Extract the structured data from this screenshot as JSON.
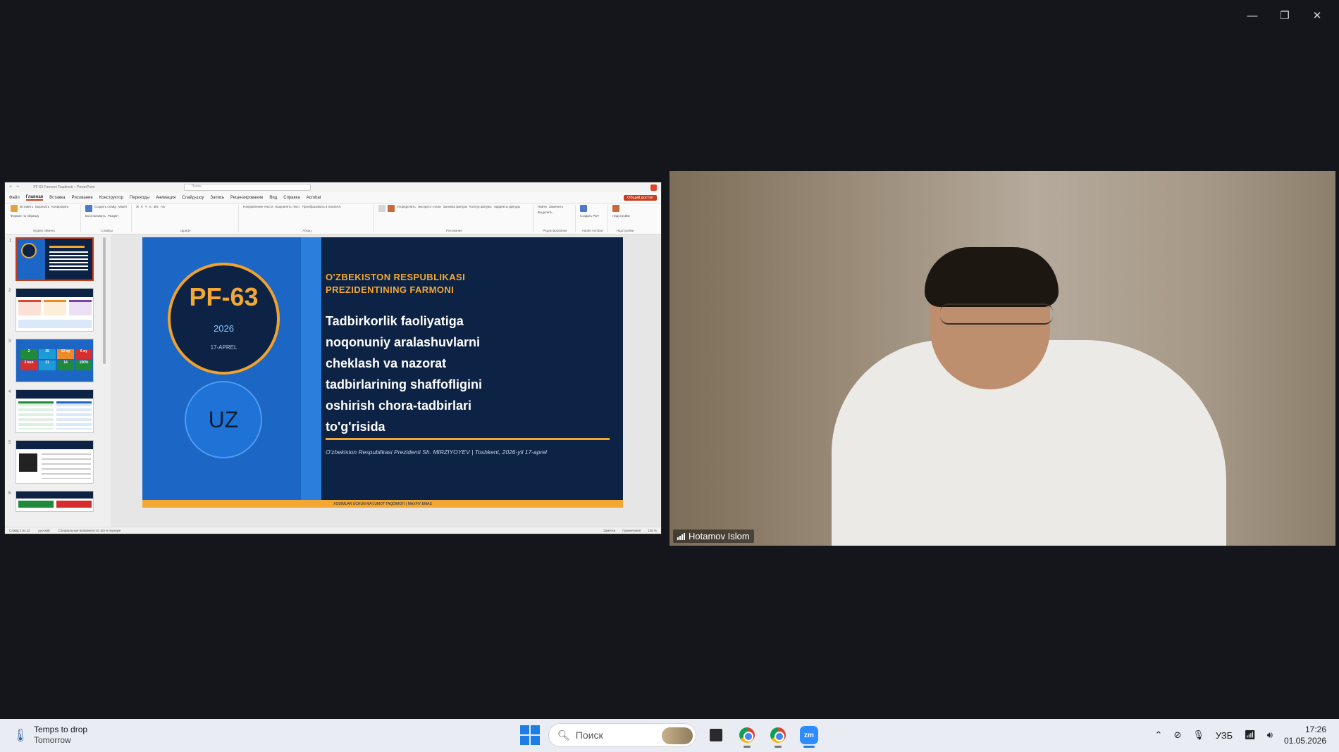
{
  "window_controls": {
    "minimize": "—",
    "restore": "❐",
    "close": "✕"
  },
  "ppt": {
    "title": "PF-63 Farmoni Taqdimoti – PowerPoint",
    "search_placeholder": "Поиск",
    "menu": [
      "Файл",
      "Главная",
      "Вставка",
      "Рисование",
      "Конструктор",
      "Переходы",
      "Анимация",
      "Слайд-шоу",
      "Запись",
      "Рецензирование",
      "Вид",
      "Справка",
      "Acrobat"
    ],
    "share_label": "Общий доступ",
    "ribbon_groups": [
      {
        "items": [
          "Вставить",
          "Вырезать",
          "Копировать",
          "Формат по образцу"
        ],
        "label": "Буфер обмена"
      },
      {
        "items": [
          "Создать слайд",
          "Макет",
          "Восстановить",
          "Раздел"
        ],
        "label": "Слайды"
      },
      {
        "items": [
          "Ж",
          "К",
          "Ч",
          "S",
          "abc",
          "Aa"
        ],
        "label": "Шрифт"
      },
      {
        "items": [
          "Направление текста",
          "Выровнять текст",
          "Преобразовать в SmartArt"
        ],
        "label": "Абзац"
      },
      {
        "items": [
          "Упорядочить",
          "Экспресс-стили",
          "Заливка фигуры",
          "Контур фигуры",
          "Эффекты фигуры"
        ],
        "label": "Рисование"
      },
      {
        "items": [
          "Найти",
          "Заменить",
          "Выделить"
        ],
        "label": "Редактирование"
      },
      {
        "items": [
          "Создать PDF"
        ],
        "label": "Adobe Acrobat"
      },
      {
        "items": [
          "Надстройки"
        ],
        "label": "Надстройки"
      }
    ],
    "thumb_numbers": [
      "1",
      "2",
      "3",
      "4",
      "5",
      "6"
    ],
    "status_left": "Слайд 1 из 12",
    "status_lang": "русский",
    "status_access": "Специальные возможности: все в порядке",
    "status_notes": "Заметки",
    "status_comments": "Примечания",
    "status_zoom": "146 %"
  },
  "slide": {
    "badge_code": "PF-63",
    "badge_year": "2026",
    "badge_date": "17-APREL",
    "country": "UZ",
    "title_lines": [
      "O'ZBEKISTON RESPUBLIKASI",
      "PREZIDENTINING FARMONI"
    ],
    "body_lines": [
      "Tadbirkorlik faoliyatiga",
      "noqonuniy aralashuvlarni",
      "cheklash va nazorat",
      "tadbirlarining shaffofligini",
      "oshirish chora-tadbirlari",
      "to'g'risida"
    ],
    "footer": "O'zbekiston Respublikasi Prezidenti Sh. MIRZIYOYEV  |  Toshkent, 2026-yil 17-aprel",
    "bottom_bar": "XODIMLAR UCHUN MA'LUMOT TAQDIMOTI  |  MAXFIY EMAS"
  },
  "thumb2": {
    "stat_values": [
      "2",
      "15",
      "12 oy",
      "6 oy",
      "3 kun",
      "31",
      "14",
      "100%"
    ]
  },
  "video": {
    "participant_name": "Hotamov Islom"
  },
  "taskbar": {
    "weather_title": "Temps to drop",
    "weather_sub": "Tomorrow",
    "search_placeholder": "Поиск",
    "zoom_label": "zm",
    "lang": "УЗБ",
    "time": "17:26",
    "date": "01.05.2026"
  },
  "colors": {
    "slide_navy": "#0d2345",
    "slide_blue": "#1c66c6",
    "accent_orange": "#f3a833",
    "ppt_accent": "#c43e1c"
  }
}
